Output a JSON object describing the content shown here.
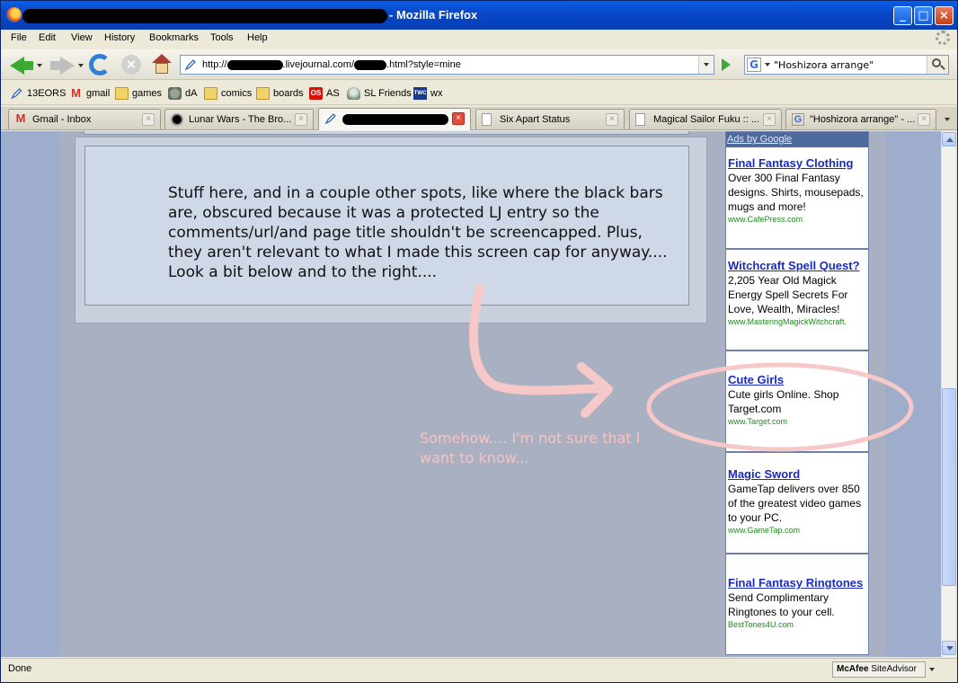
{
  "window": {
    "title": "- Mozilla Firefox",
    "buttons": {
      "minimize": "_",
      "maximize": "□",
      "close": "×"
    }
  },
  "menu": [
    "File",
    "Edit",
    "View",
    "History",
    "Bookmarks",
    "Tools",
    "Help"
  ],
  "nav": {
    "url_prefix": "http://",
    "url_mid": ".livejournal.com/",
    "url_suffix": ".html?style=mine",
    "search_value": "\"Hoshizora arrange\""
  },
  "bookmarks": [
    {
      "label": "13EORS",
      "icon": "livejournal-pen-icon"
    },
    {
      "label": "gmail",
      "icon": "gmail-icon"
    },
    {
      "label": "games",
      "icon": "folder-icon"
    },
    {
      "label": "dA",
      "icon": "deviantart-icon"
    },
    {
      "label": "comics",
      "icon": "folder-icon"
    },
    {
      "label": "boards",
      "icon": "folder-icon"
    },
    {
      "label": "AS",
      "icon": "lastfm-icon"
    },
    {
      "label": "SL Friends",
      "icon": "second-life-icon"
    },
    {
      "label": "wx",
      "icon": "weather-channel-icon"
    }
  ],
  "tabs": [
    {
      "label": "Gmail - Inbox",
      "icon": "gmail-icon",
      "active": false
    },
    {
      "label": "Lunar Wars - The Bro...",
      "icon": "moon-icon",
      "active": false
    },
    {
      "label": "",
      "icon": "livejournal-pen-icon",
      "active": true
    },
    {
      "label": "Six Apart Status",
      "icon": "page-icon",
      "active": false
    },
    {
      "label": "Magical Sailor Fuku :: ...",
      "icon": "page-icon",
      "active": false
    },
    {
      "label": "\"Hoshizora arrange\" - ...",
      "icon": "google-icon",
      "active": false
    }
  ],
  "entry": {
    "text": "Stuff here, and in a couple other spots, like where the black bars are, obscured because it was a protected LJ entry so the comments/url/and page title shouldn't be screencapped. Plus, they aren't relevant to what I made this screen cap for anyway.... Look a bit below and to the right...."
  },
  "annotation": {
    "text": "Somehow.... I'm not sure that I want to know..."
  },
  "ads": {
    "header": "Ads by Google",
    "items": [
      {
        "title": "Final Fantasy Clothing",
        "desc": "Over 300 Final Fantasy designs. Shirts, mousepads, mugs and more!",
        "url": "www.CafePress.com"
      },
      {
        "title": "Witchcraft Spell Quest?",
        "desc": "2,205 Year Old Magick Energy Spell Secrets For Love, Wealth, Miracles!",
        "url": "www.MasteringMagickWitchcraft."
      },
      {
        "title": "Cute Girls",
        "desc": "Cute girls Online. Shop Target.com",
        "url": "www.Target.com"
      },
      {
        "title": "Magic Sword",
        "desc": "GameTap delivers over 850 of the greatest video games to your PC.",
        "url": "www.GameTap.com"
      },
      {
        "title": "Final Fantasy Ringtones",
        "desc": "Send Complimentary Ringtones to your cell.",
        "url": "BestTones4U.com"
      }
    ]
  },
  "status": {
    "text": "Done",
    "mcafee_brand": "McAfee",
    "mcafee_product": "SiteAdvisor"
  },
  "colors": {
    "annotation_pink": "#F6C3C3",
    "ad_title_blue": "#1A2AC4",
    "ad_url_green": "#1F8A1F"
  }
}
